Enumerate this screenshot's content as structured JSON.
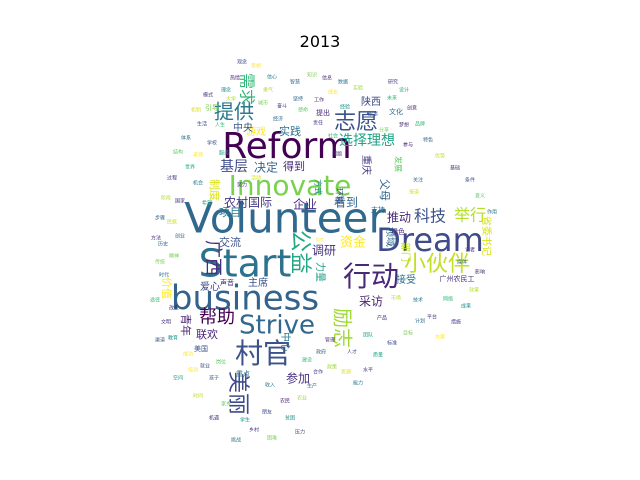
{
  "title": "2013",
  "words": [
    {
      "text": "Volunteer",
      "color": "#31688e"
    },
    {
      "text": "Start",
      "color": "#2c728e"
    },
    {
      "text": "business",
      "color": "#33638d"
    },
    {
      "text": "Reform",
      "color": "#440154"
    },
    {
      "text": "Dream",
      "color": "#3e4a89"
    },
    {
      "text": "Innovate",
      "color": "#7ad151"
    },
    {
      "text": "Strive",
      "color": "#31688e"
    },
    {
      "text": "村官",
      "color": "#3b528b"
    },
    {
      "text": "行动",
      "color": "#482878"
    },
    {
      "text": "小伙伴",
      "color": "#c2df23"
    },
    {
      "text": "志愿",
      "color": "#3b528b"
    },
    {
      "text": "提供",
      "color": "#2a788e"
    },
    {
      "text": "美丽",
      "color": "#3e4a89"
    },
    {
      "text": "公益",
      "color": "#22a884"
    },
    {
      "text": "励志",
      "color": "#a0da39"
    },
    {
      "text": "广西",
      "color": "#46307e"
    },
    {
      "text": "帮助",
      "color": "#440154"
    },
    {
      "text": "需求",
      "color": "#35b779"
    },
    {
      "text": "选择理想",
      "color": "#20a486"
    },
    {
      "text": "科技",
      "color": "#3b528b"
    },
    {
      "text": "举行",
      "color": "#b5de2b"
    },
    {
      "text": "基层",
      "color": "#3e4a89"
    },
    {
      "text": "决定",
      "color": "#31688e"
    },
    {
      "text": "得到",
      "color": "#482878"
    },
    {
      "text": "实践",
      "color": "#2c728e"
    },
    {
      "text": "游戏",
      "color": "#fde725"
    },
    {
      "text": "中央",
      "color": "#38588c"
    },
    {
      "text": "农村国际",
      "color": "#443983"
    },
    {
      "text": "企业",
      "color": "#46307e"
    },
    {
      "text": "看到",
      "color": "#31688e"
    },
    {
      "text": "项目",
      "color": "#2a788e"
    },
    {
      "text": "制度",
      "color": "#d8e219"
    },
    {
      "text": "交流",
      "color": "#3b528b"
    },
    {
      "text": "调研",
      "color": "#46307e"
    },
    {
      "text": "资金",
      "color": "#fde725"
    },
    {
      "text": "推动",
      "color": "#482878"
    },
    {
      "text": "采访",
      "color": "#481f70"
    },
    {
      "text": "接受",
      "color": "#2c728e"
    },
    {
      "text": "联欢",
      "color": "#482878"
    },
    {
      "text": "爱心",
      "color": "#3e4a89"
    },
    {
      "text": "主席",
      "color": "#3b528b"
    },
    {
      "text": "参加",
      "color": "#46307e"
    },
    {
      "text": "中心",
      "color": "#2a788e"
    },
    {
      "text": "陕西",
      "color": "#3e4a89"
    },
    {
      "text": "重庆",
      "color": "#443983"
    },
    {
      "text": "父母",
      "color": "#31688e"
    },
    {
      "text": "价值",
      "color": "#fde725"
    },
    {
      "text": "青年",
      "color": "#481f70"
    },
    {
      "text": "省委书记",
      "color": "#d8e219"
    },
    {
      "text": "部门",
      "color": "#c2df23"
    },
    {
      "text": "领域",
      "color": "#31688e"
    },
    {
      "text": "力量",
      "color": "#1f9e89"
    },
    {
      "text": "环境",
      "color": "#3e4a89"
    },
    {
      "text": "方式",
      "color": "#21918c"
    },
    {
      "text": "发展",
      "color": "#5ec962"
    },
    {
      "text": "文化",
      "color": "#31688e"
    },
    {
      "text": "支持",
      "color": "#2c728e"
    },
    {
      "text": "提出",
      "color": "#482878"
    },
    {
      "text": "引导",
      "color": "#7ad151"
    },
    {
      "text": "绿色",
      "color": "#46307e"
    },
    {
      "text": "广州农民工",
      "color": "#46307e"
    },
    {
      "text": "声音",
      "color": "#482878"
    },
    {
      "text": "美国",
      "color": "#3b528b"
    },
    {
      "text": "重点",
      "color": "#2c728e"
    },
    {
      "text": "城市",
      "color": "#7ad151"
    },
    {
      "text": "经济",
      "color": "#31688e"
    },
    {
      "text": "社会",
      "color": "#35b779"
    },
    {
      "text": "朋友",
      "color": "#3e4a89"
    },
    {
      "text": "学生",
      "color": "#21918c"
    },
    {
      "text": "老师",
      "color": "#fde725"
    },
    {
      "text": "服务",
      "color": "#20a486"
    },
    {
      "text": "工作",
      "color": "#482878"
    },
    {
      "text": "活动",
      "color": "#d8e219"
    },
    {
      "text": "问题",
      "color": "#443983"
    },
    {
      "text": "机会",
      "color": "#2a788e"
    },
    {
      "text": "未来",
      "color": "#35b779"
    },
    {
      "text": "梦想",
      "color": "#46307e"
    },
    {
      "text": "创业",
      "color": "#31688e"
    },
    {
      "text": "大学",
      "color": "#b5de2b"
    },
    {
      "text": "学校",
      "color": "#3b528b"
    },
    {
      "text": "希望",
      "color": "#22a884"
    },
    {
      "text": "努力",
      "color": "#443983"
    },
    {
      "text": "精神",
      "color": "#7ad151"
    },
    {
      "text": "时代",
      "color": "#2c728e"
    },
    {
      "text": "改变",
      "color": "#481f70"
    },
    {
      "text": "成功",
      "color": "#fde725"
    },
    {
      "text": "孩子",
      "color": "#38588c"
    },
    {
      "text": "家乡",
      "color": "#5ec962"
    },
    {
      "text": "乡村",
      "color": "#46307e"
    },
    {
      "text": "贫困",
      "color": "#21918c"
    },
    {
      "text": "政府",
      "color": "#31688e"
    },
    {
      "text": "政策",
      "color": "#a0da39"
    },
    {
      "text": "人才",
      "color": "#3e4a89"
    },
    {
      "text": "团队",
      "color": "#20a486"
    },
    {
      "text": "产品",
      "color": "#482878"
    },
    {
      "text": "市场",
      "color": "#c2df23"
    },
    {
      "text": "技术",
      "color": "#2a788e"
    },
    {
      "text": "平台",
      "color": "#443983"
    },
    {
      "text": "网络",
      "color": "#35b779"
    },
    {
      "text": "媒体",
      "color": "#31688e"
    },
    {
      "text": "记者",
      "color": "#46307e"
    },
    {
      "text": "报道",
      "color": "#d8e219"
    },
    {
      "text": "关注",
      "color": "#2c728e"
    },
    {
      "text": "参与",
      "color": "#481f70"
    },
    {
      "text": "分享",
      "color": "#7ad151"
    },
    {
      "text": "故事",
      "color": "#3b528b"
    },
    {
      "text": "经验",
      "color": "#21918c"
    },
    {
      "text": "成长",
      "color": "#fde725"
    },
    {
      "text": "责任",
      "color": "#443983"
    },
    {
      "text": "使命",
      "color": "#5ec962"
    },
    {
      "text": "坚持",
      "color": "#31688e"
    },
    {
      "text": "奋斗",
      "color": "#46307e"
    },
    {
      "text": "勇气",
      "color": "#b5de2b"
    },
    {
      "text": "信心",
      "color": "#2a788e"
    },
    {
      "text": "热情",
      "color": "#482878"
    },
    {
      "text": "人生",
      "color": "#35b779"
    },
    {
      "text": "生活",
      "color": "#3e4a89"
    },
    {
      "text": "世界",
      "color": "#20a486"
    },
    {
      "text": "国家",
      "color": "#443983"
    },
    {
      "text": "民族",
      "color": "#c2df23"
    },
    {
      "text": "历史",
      "color": "#31688e"
    },
    {
      "text": "传统",
      "color": "#7ad151"
    },
    {
      "text": "文明",
      "color": "#46307e"
    },
    {
      "text": "教育",
      "color": "#21918c"
    },
    {
      "text": "培训",
      "color": "#fde725"
    },
    {
      "text": "就业",
      "color": "#3b528b"
    },
    {
      "text": "岗位",
      "color": "#5ec962"
    },
    {
      "text": "收入",
      "color": "#2c728e"
    },
    {
      "text": "农民",
      "color": "#481f70"
    },
    {
      "text": "农业",
      "color": "#a0da39"
    },
    {
      "text": "生产",
      "color": "#31688e"
    },
    {
      "text": "合作",
      "color": "#443983"
    },
    {
      "text": "建设",
      "color": "#35b779"
    },
    {
      "text": "管理",
      "color": "#482878"
    },
    {
      "text": "资源",
      "color": "#d8e219"
    },
    {
      "text": "能力",
      "color": "#2a788e"
    },
    {
      "text": "水平",
      "color": "#46307e"
    },
    {
      "text": "质量",
      "color": "#20a486"
    },
    {
      "text": "标准",
      "color": "#3e4a89"
    },
    {
      "text": "目标",
      "color": "#7ad151"
    },
    {
      "text": "计划",
      "color": "#31688e"
    },
    {
      "text": "方案",
      "color": "#fde725"
    },
    {
      "text": "措施",
      "color": "#443983"
    },
    {
      "text": "成果",
      "color": "#21918c"
    },
    {
      "text": "效果",
      "color": "#b5de2b"
    },
    {
      "text": "影响",
      "color": "#482878"
    },
    {
      "text": "作用",
      "color": "#2c728e"
    },
    {
      "text": "意义",
      "color": "#5ec962"
    },
    {
      "text": "条件",
      "color": "#3b528b"
    },
    {
      "text": "基础",
      "color": "#46307e"
    },
    {
      "text": "优势",
      "color": "#c2df23"
    },
    {
      "text": "特色",
      "color": "#31688e"
    },
    {
      "text": "品牌",
      "color": "#35b779"
    },
    {
      "text": "创意",
      "color": "#481f70"
    },
    {
      "text": "设计",
      "color": "#20a486"
    },
    {
      "text": "研究",
      "color": "#443983"
    },
    {
      "text": "实验",
      "color": "#a0da39"
    },
    {
      "text": "数据",
      "color": "#2a788e"
    },
    {
      "text": "信息",
      "color": "#482878"
    },
    {
      "text": "知识",
      "color": "#7ad151"
    },
    {
      "text": "智慧",
      "color": "#31688e"
    },
    {
      "text": "思想",
      "color": "#fde725"
    },
    {
      "text": "观念",
      "color": "#3e4a89"
    },
    {
      "text": "理念",
      "color": "#21918c"
    },
    {
      "text": "模式",
      "color": "#46307e"
    },
    {
      "text": "机制",
      "color": "#d8e219"
    },
    {
      "text": "体系",
      "color": "#2c728e"
    },
    {
      "text": "结构",
      "color": "#5ec962"
    },
    {
      "text": "过程",
      "color": "#443983"
    },
    {
      "text": "阶段",
      "color": "#b5de2b"
    },
    {
      "text": "步骤",
      "color": "#31688e"
    },
    {
      "text": "方法",
      "color": "#482878"
    },
    {
      "text": "途径",
      "color": "#35b779"
    },
    {
      "text": "渠道",
      "color": "#3b528b"
    },
    {
      "text": "空间",
      "color": "#20a486"
    },
    {
      "text": "时间",
      "color": "#c2df23"
    },
    {
      "text": "机遇",
      "color": "#46307e"
    },
    {
      "text": "挑战",
      "color": "#2a788e"
    },
    {
      "text": "困难",
      "color": "#7ad151"
    },
    {
      "text": "压力",
      "color": "#443983"
    },
    {
      "text": "风险",
      "color": "#fde725"
    }
  ]
}
